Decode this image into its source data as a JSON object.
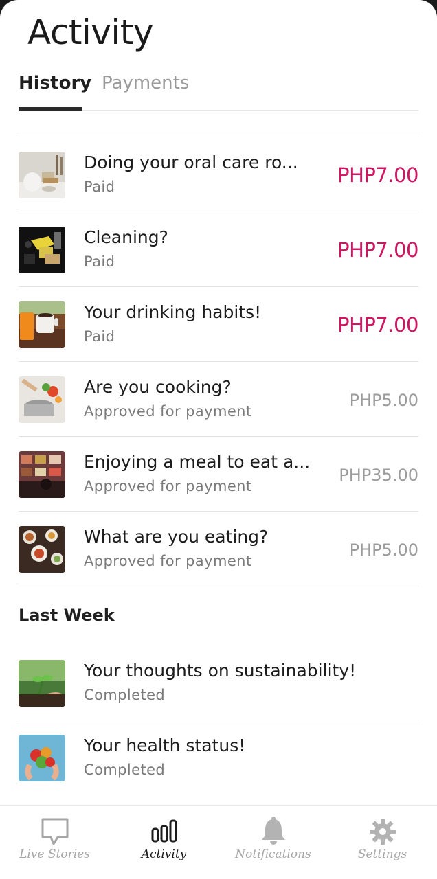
{
  "page": {
    "title": "Activity"
  },
  "tabs": [
    {
      "label": "History",
      "active": true
    },
    {
      "label": "Payments",
      "active": false
    }
  ],
  "colors": {
    "paid_amount": "#cf1662",
    "pending_amount": "#9b9b9b",
    "active_tab_underline": "#2a2a2a"
  },
  "history": [
    {
      "thumb_icon": "oral-care-photo",
      "title": "Doing your oral care ro...",
      "status": "Paid",
      "amount": "PHP7.00",
      "paid": true
    },
    {
      "thumb_icon": "cleaning-photo",
      "title": "Cleaning?",
      "status": "Paid",
      "amount": "PHP7.00",
      "paid": true
    },
    {
      "thumb_icon": "drinks-photo",
      "title": "Your drinking habits!",
      "status": "Paid",
      "amount": "PHP7.00",
      "paid": true
    },
    {
      "thumb_icon": "cooking-photo",
      "title": "Are you cooking?",
      "status": "Approved for payment",
      "amount": "PHP5.00",
      "paid": false
    },
    {
      "thumb_icon": "restaurant-meal-photo",
      "title": "Enjoying a meal to eat a...",
      "status": "Approved for payment",
      "amount": "PHP35.00",
      "paid": false
    },
    {
      "thumb_icon": "food-table-photo",
      "title": "What are you eating?",
      "status": "Approved for payment",
      "amount": "PHP5.00",
      "paid": false
    }
  ],
  "last_week": {
    "heading": "Last Week",
    "items": [
      {
        "thumb_icon": "sprout-photo",
        "title": "Your thoughts on sustainability!",
        "status": "Completed"
      },
      {
        "thumb_icon": "fruits-photo",
        "title": "Your health status!",
        "status": "Completed"
      }
    ]
  },
  "bottom_nav": [
    {
      "label": "Live Stories",
      "icon": "speech-bubble-icon",
      "active": false
    },
    {
      "label": "Activity",
      "icon": "bar-chart-icon",
      "active": true
    },
    {
      "label": "Notifications",
      "icon": "bell-icon",
      "active": false
    },
    {
      "label": "Settings",
      "icon": "gear-icon",
      "active": false
    }
  ]
}
